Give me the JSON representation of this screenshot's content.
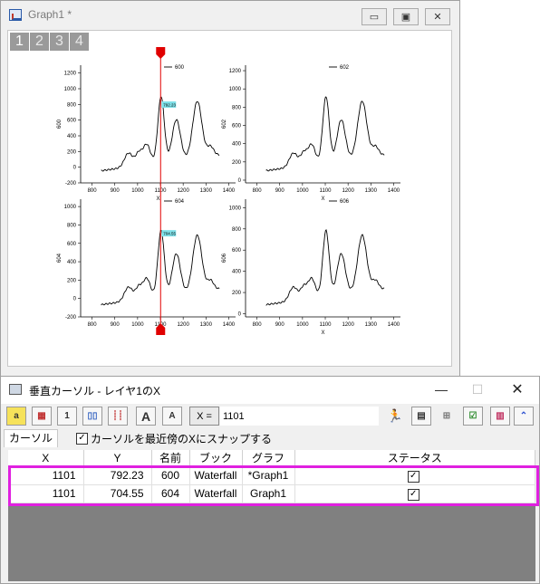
{
  "graph_window": {
    "title": "Graph1 *",
    "minimize_label": "▭",
    "maximize_label": "▣",
    "close_label": "✕",
    "layer_tabs": [
      "1",
      "2",
      "3",
      "4"
    ],
    "active_layer": "1"
  },
  "chart_data": [
    {
      "type": "line",
      "panel": "top-left",
      "series": [
        {
          "name": "600"
        }
      ],
      "ylabel": "600",
      "xlabel": "X",
      "xticks": [
        "800",
        "900",
        "1000",
        "1100",
        "1200",
        "1300",
        "1400"
      ],
      "yticks": [
        "-200",
        "0",
        "200",
        "400",
        "600",
        "800",
        "1000",
        "1200"
      ],
      "xlim": [
        750,
        1430
      ],
      "ylim": [
        -200,
        1300
      ],
      "cursor_x": 1101,
      "cursor_label": "792.23"
    },
    {
      "type": "line",
      "panel": "top-right",
      "series": [
        {
          "name": "602"
        }
      ],
      "ylabel": "602",
      "xlabel": "X",
      "xticks": [
        "800",
        "900",
        "1000",
        "1100",
        "1200",
        "1300",
        "1400"
      ],
      "yticks": [
        "0",
        "200",
        "400",
        "600",
        "800",
        "1000",
        "1200"
      ],
      "xlim": [
        750,
        1430
      ],
      "ylim": [
        -30,
        1260
      ]
    },
    {
      "type": "line",
      "panel": "bottom-left",
      "series": [
        {
          "name": "604"
        }
      ],
      "ylabel": "604",
      "xlabel": "X",
      "xticks": [
        "800",
        "900",
        "1000",
        "1100",
        "1200",
        "1300",
        "1400"
      ],
      "yticks": [
        "-200",
        "0",
        "200",
        "400",
        "600",
        "800",
        "1000"
      ],
      "xlim": [
        750,
        1430
      ],
      "ylim": [
        -200,
        1080
      ],
      "cursor_x": 1101,
      "cursor_label": "704.55"
    },
    {
      "type": "line",
      "panel": "bottom-right",
      "series": [
        {
          "name": "606"
        }
      ],
      "ylabel": "606",
      "xlabel": "X",
      "xticks": [
        "800",
        "900",
        "1000",
        "1100",
        "1200",
        "1300",
        "1400"
      ],
      "yticks": [
        "0",
        "200",
        "400",
        "600",
        "800",
        "1000"
      ],
      "xlim": [
        750,
        1430
      ],
      "ylim": [
        -30,
        1080
      ]
    }
  ],
  "cursor_window": {
    "title": "垂直カーソル - レイヤ1のX",
    "minimize_label": "—",
    "maximize_label": "☐",
    "close_label": "✕",
    "x_equals_label": "X =",
    "x_value": "1101",
    "tab_label": "カーソル",
    "snap_checkbox_label": "カーソルを最近傍のXにスナップする",
    "snap_checked": true,
    "table": {
      "headers": [
        "X",
        "Y",
        "名前",
        "ブック",
        "グラフ",
        "ステータス"
      ],
      "rows": [
        {
          "x": "1101",
          "y": "792.23",
          "name": "600",
          "book": "Waterfall",
          "graph": "*Graph1",
          "status": true
        },
        {
          "x": "1101",
          "y": "704.55",
          "name": "604",
          "book": "Waterfall",
          "graph": "Graph1",
          "status": true
        }
      ]
    }
  },
  "colors": {
    "cursor_line": "#e00000",
    "highlight": "#e020e0",
    "curve": "#000000",
    "cursor_label_bg": "#7fe0e8"
  }
}
